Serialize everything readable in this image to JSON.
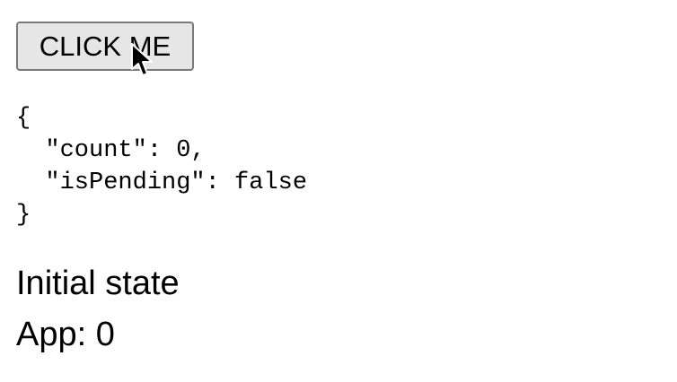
{
  "button": {
    "label": "CLICK ME"
  },
  "state_json": "{\n  \"count\": 0,\n  \"isPending\": false\n}",
  "status": {
    "label": "Initial state"
  },
  "app": {
    "label": "App: 0"
  },
  "icons": {
    "cursor": "mouse-pointer-icon"
  },
  "colors": {
    "button_bg": "#e6e6e6",
    "button_border": "#7a7a7a",
    "text": "#000000",
    "background": "#ffffff"
  }
}
